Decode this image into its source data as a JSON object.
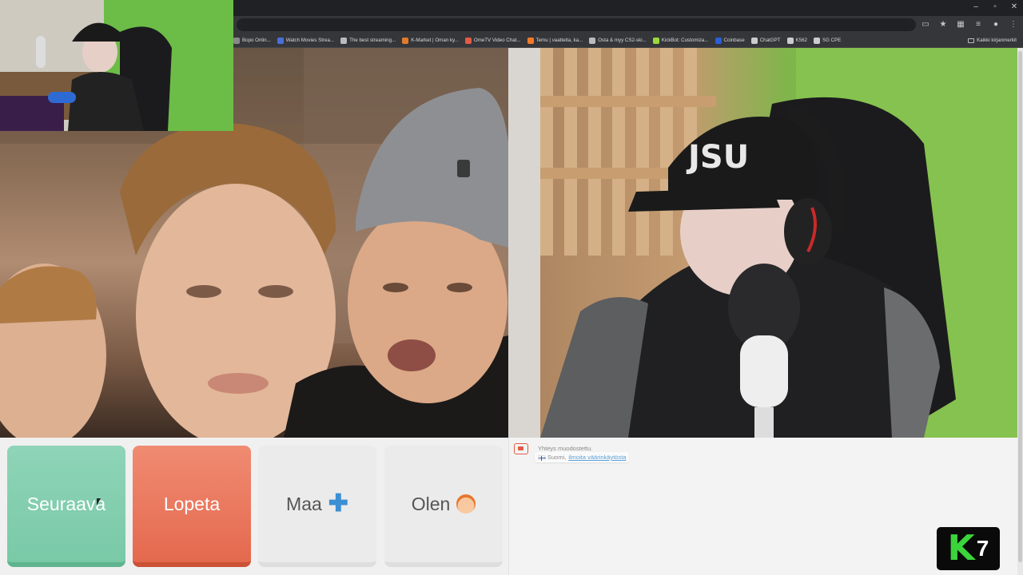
{
  "browser": {
    "window_controls": {
      "minimize": "–",
      "maximize": "▫",
      "close": "✕"
    },
    "toolbar_icons": [
      "cast-icon",
      "star-icon",
      "extensions-icon",
      "media-icon",
      "profile-icon",
      "menu-icon"
    ],
    "bookmarks": [
      {
        "label": "Bopo Onlin...",
        "icon": "page-icon",
        "color": "#888888"
      },
      {
        "label": "Watch Movies Strea...",
        "icon": "page-icon",
        "color": "#4a6fd8"
      },
      {
        "label": "The best streaming...",
        "icon": "diamond-icon",
        "color": "#bbbbbb"
      },
      {
        "label": "K-Market | Oman ky...",
        "icon": "k-icon",
        "color": "#e27b2b"
      },
      {
        "label": "OmeTV Video Chat...",
        "icon": "ometv-icon",
        "color": "#e25b45"
      },
      {
        "label": "Temu | vaatteita, ka...",
        "icon": "temu-icon",
        "color": "#f07a2a"
      },
      {
        "label": "Osta & myy CS2-ski...",
        "icon": "cloud-icon",
        "color": "#bbbbbb"
      },
      {
        "label": "KickBot: Customiza...",
        "icon": "kick-icon",
        "color": "#9ad83b"
      },
      {
        "label": "Coinbase",
        "icon": "coinbase-icon",
        "color": "#2a5fd8"
      },
      {
        "label": "ChatGPT",
        "icon": "chatgpt-icon",
        "color": "#cccccc"
      },
      {
        "label": "K562",
        "icon": "k-icon",
        "color": "#cccccc"
      },
      {
        "label": "SG CPE",
        "icon": "page-icon",
        "color": "#cccccc"
      }
    ],
    "all_bookmarks": "Kaikki kirjanmerkit"
  },
  "controls": {
    "next_label": "Seuraava",
    "stop_label": "Lopeta",
    "country_label": "Maa",
    "gender_label": "Olen"
  },
  "chat": {
    "status": "Yhteys muodostettu.",
    "country_prefix": "Suomi,",
    "country_link": "ilmoita väärinkäytösta"
  },
  "badge": {
    "k": "K",
    "num": "7"
  },
  "colors": {
    "next": "#79c9a7",
    "stop": "#e4694e",
    "accent_plus": "#3d8fd4",
    "badge_green": "#3bd43b"
  }
}
